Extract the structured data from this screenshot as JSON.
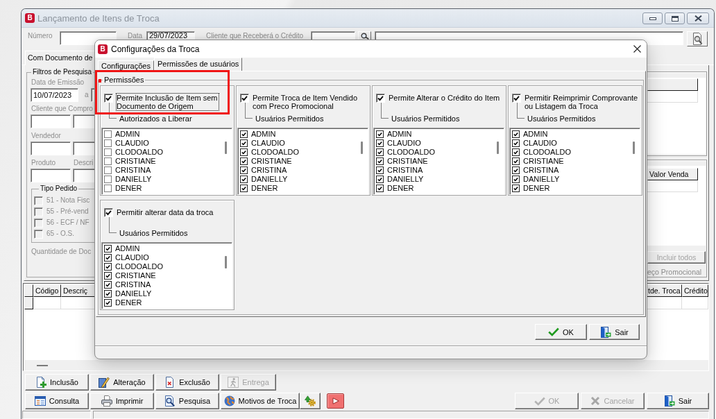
{
  "main_window": {
    "logo": "B",
    "title": "Lançamento de Itens de Troca",
    "header": {
      "disabled": true,
      "number_label": "Número",
      "date_label": "Data",
      "date_value": "29/07/2023",
      "client_label": "Cliente que Receberá o Crédito"
    },
    "tabs": [
      {
        "label": "Com Documento de",
        "selected": true
      }
    ],
    "filters": {
      "title": "Filtros de Pesquisa",
      "disabled": true,
      "issue_date_label": "Data de Emissão",
      "issue_date_from": "10/07/2023",
      "range_separator": "a",
      "buyer_label": "Cliente que Compro",
      "seller_label": "Vendedor",
      "product_label": "Produto",
      "description_label": "Descri",
      "order_type": {
        "title": "Tipo Pedido",
        "options": [
          {
            "label": "51 - Nota Fisc",
            "checked": false
          },
          {
            "label": "55 - Pré-vend",
            "checked": false
          },
          {
            "label": "56 - ECF / NF",
            "checked": false
          },
          {
            "label": "65 - O.S.",
            "checked": false
          }
        ]
      },
      "quantity_label": "Quantidade de Doc"
    },
    "side_panel": {
      "grid_columns": [
        "Valor Venda"
      ],
      "include_all_button": {
        "label": "Incluir todos",
        "disabled": true
      },
      "promo_option": {
        "label": "eço Promocional",
        "disabled": true
      }
    },
    "items_table": {
      "columns_left": [
        "Código",
        "Descriç"
      ],
      "columns_right": [
        "tde. Troca",
        "Crédito"
      ]
    },
    "toolbar": {
      "row_1": [
        {
          "label": "Inclusão",
          "disabled": false
        },
        {
          "label": "Alteração",
          "disabled": false
        },
        {
          "label": "Exclusão",
          "disabled": false
        },
        {
          "label": "Entrega",
          "disabled": true
        }
      ],
      "row_2": [
        {
          "label": "Consulta",
          "disabled": false
        },
        {
          "label": "Imprimir",
          "disabled": false
        },
        {
          "label": "Pesquisa",
          "disabled": false
        },
        {
          "label": "Motivos de Troca",
          "disabled": false
        }
      ],
      "footer": [
        {
          "label": "OK",
          "disabled": true
        },
        {
          "label": "Cancelar",
          "disabled": true
        },
        {
          "label": "Sair",
          "disabled": false
        }
      ]
    }
  },
  "dialog": {
    "logo": "B",
    "title": "Configurações da Troca",
    "tabs": [
      {
        "label": "Configurações",
        "selected": false
      },
      {
        "label": "Permissões de usuários",
        "selected": true
      }
    ],
    "group_title": "Permissões",
    "permissions": [
      {
        "label": "Permite Inclusão de Item sem Documento de Origem",
        "checked": true,
        "focused": true,
        "highlighted": true,
        "users_label": "Autorizados a Liberar",
        "users": [
          {
            "name": "ADMIN",
            "checked": false
          },
          {
            "name": "CLAUDIO",
            "checked": false
          },
          {
            "name": "CLODOALDO",
            "checked": false
          },
          {
            "name": "CRISTIANE",
            "checked": false
          },
          {
            "name": "CRISTINA",
            "checked": false
          },
          {
            "name": "DANIELLY",
            "checked": false
          },
          {
            "name": "DENER",
            "checked": false
          }
        ]
      },
      {
        "label": "Permite Troca de Item Vendido com Preco Promocional",
        "checked": true,
        "focused": false,
        "highlighted": false,
        "users_label": "Usuários Permitidos",
        "users": [
          {
            "name": "ADMIN",
            "checked": true
          },
          {
            "name": "CLAUDIO",
            "checked": true
          },
          {
            "name": "CLODOALDO",
            "checked": true
          },
          {
            "name": "CRISTIANE",
            "checked": true
          },
          {
            "name": "CRISTINA",
            "checked": true
          },
          {
            "name": "DANIELLY",
            "checked": true
          },
          {
            "name": "DENER",
            "checked": true
          }
        ]
      },
      {
        "label": "Permite Alterar o Crédito do Item",
        "checked": true,
        "focused": false,
        "highlighted": false,
        "users_label": "Usuários Permitidos",
        "users": [
          {
            "name": "ADMIN",
            "checked": true
          },
          {
            "name": "CLAUDIO",
            "checked": true
          },
          {
            "name": "CLODOALDO",
            "checked": true
          },
          {
            "name": "CRISTIANE",
            "checked": true
          },
          {
            "name": "CRISTINA",
            "checked": true
          },
          {
            "name": "DANIELLY",
            "checked": true
          },
          {
            "name": "DENER",
            "checked": true
          }
        ]
      },
      {
        "label": "Permitir Reimprimir Comprovante ou Listagem da Troca",
        "checked": true,
        "focused": false,
        "highlighted": false,
        "users_label": "Usuários Permitidos",
        "users": [
          {
            "name": "ADMIN",
            "checked": true
          },
          {
            "name": "CLAUDIO",
            "checked": true
          },
          {
            "name": "CLODOALDO",
            "checked": true
          },
          {
            "name": "CRISTIANE",
            "checked": true
          },
          {
            "name": "CRISTINA",
            "checked": true
          },
          {
            "name": "DANIELLY",
            "checked": true
          },
          {
            "name": "DENER",
            "checked": true
          }
        ]
      },
      {
        "label": "Permitir alterar data da troca",
        "checked": true,
        "focused": false,
        "highlighted": false,
        "users_label": "Usuários Permitidos",
        "users": [
          {
            "name": "ADMIN",
            "checked": true
          },
          {
            "name": "CLAUDIO",
            "checked": true
          },
          {
            "name": "CLODOALDO",
            "checked": true
          },
          {
            "name": "CRISTIANE",
            "checked": true
          },
          {
            "name": "CRISTINA",
            "checked": true
          },
          {
            "name": "DANIELLY",
            "checked": true
          },
          {
            "name": "DENER",
            "checked": true
          }
        ]
      }
    ],
    "buttons": [
      {
        "label": "OK"
      },
      {
        "label": "Sair"
      }
    ]
  }
}
